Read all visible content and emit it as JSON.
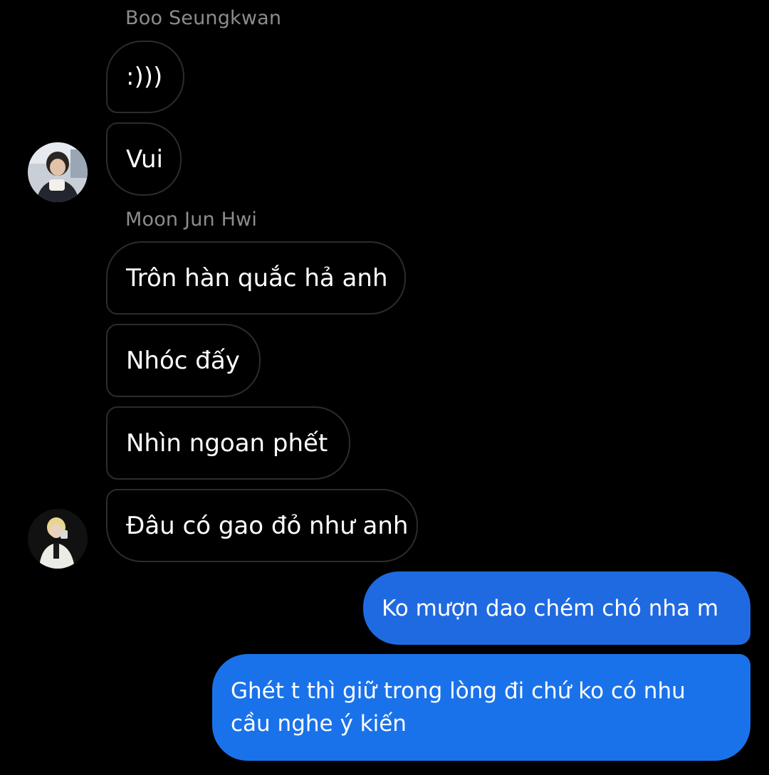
{
  "thread": {
    "groups": [
      {
        "sender": "Boo Seungkwan",
        "avatar_icon": "user-avatar-photo",
        "messages": [
          ":)))",
          "Vui"
        ]
      },
      {
        "sender": "Moon Jun Hwi",
        "avatar_icon": "user-avatar-photo",
        "messages": [
          "Trôn hàn quắc hả anh",
          "Nhóc đấy",
          "Nhìn ngoan phết",
          "Đâu có gao đỏ như anh"
        ]
      }
    ],
    "outgoing": {
      "messages": [
        "Ko mượn dao chém chó nha m",
        "Ghét t thì giữ trong lòng đi chứ ko có nhu cầu nghe ý kiến"
      ]
    }
  },
  "colors": {
    "background": "#000000",
    "incoming_bubble_border": "#2c2c2c",
    "outgoing_bubble": "#1f6ae0",
    "sender_name": "#8c8c8c"
  }
}
